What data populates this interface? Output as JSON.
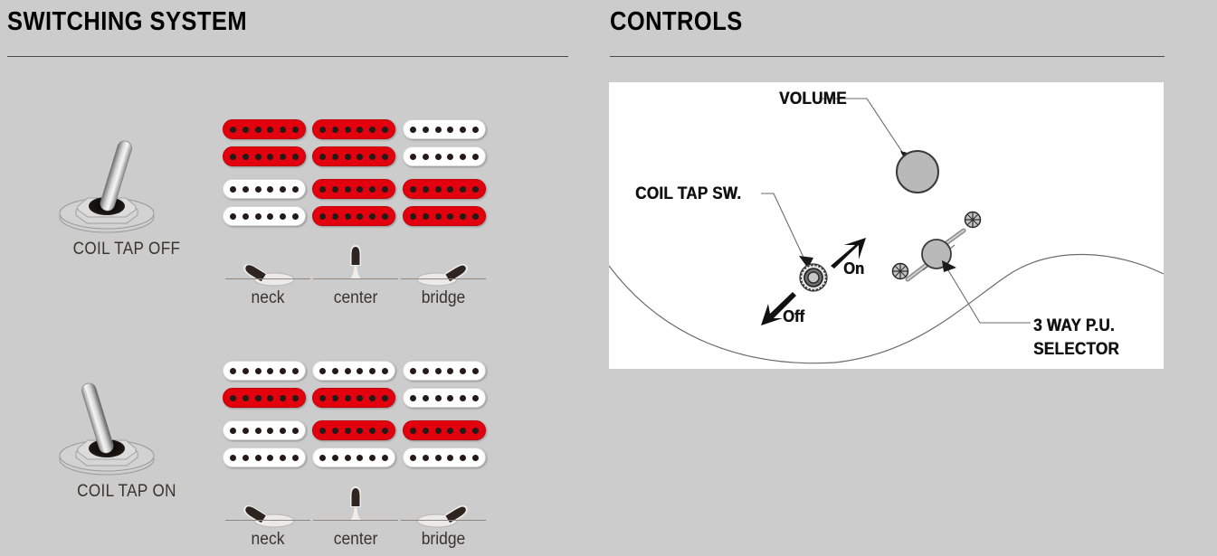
{
  "page": {
    "background_color": "#cccccc",
    "panel_color": "#ffffff",
    "active_coil_color": "#e2000f",
    "inactive_coil_color": "#ffffff"
  },
  "switching": {
    "title": "SWITCHING SYSTEM",
    "modes": [
      {
        "toggle_label": "COIL TAP OFF",
        "toggle_state": "off",
        "toggle_lean": "right",
        "positions": [
          {
            "name": "neck",
            "label": "neck",
            "lever": "left",
            "pickups": [
              {
                "slot": "neck",
                "coils": [
                  "on",
                  "on"
                ]
              },
              {
                "slot": "bridge",
                "coils": [
                  "off",
                  "off"
                ]
              }
            ]
          },
          {
            "name": "center",
            "label": "center",
            "lever": "center",
            "pickups": [
              {
                "slot": "neck",
                "coils": [
                  "on",
                  "on"
                ]
              },
              {
                "slot": "bridge",
                "coils": [
                  "on",
                  "on"
                ]
              }
            ]
          },
          {
            "name": "bridge",
            "label": "bridge",
            "lever": "right",
            "pickups": [
              {
                "slot": "neck",
                "coils": [
                  "off",
                  "off"
                ]
              },
              {
                "slot": "bridge",
                "coils": [
                  "on",
                  "on"
                ]
              }
            ]
          }
        ]
      },
      {
        "toggle_label": "COIL TAP ON",
        "toggle_state": "on",
        "toggle_lean": "left",
        "positions": [
          {
            "name": "neck",
            "label": "neck",
            "lever": "left",
            "pickups": [
              {
                "slot": "neck",
                "coils": [
                  "off",
                  "on"
                ]
              },
              {
                "slot": "bridge",
                "coils": [
                  "off",
                  "off"
                ]
              }
            ]
          },
          {
            "name": "center",
            "label": "center",
            "lever": "center",
            "pickups": [
              {
                "slot": "neck",
                "coils": [
                  "off",
                  "on"
                ]
              },
              {
                "slot": "bridge",
                "coils": [
                  "on",
                  "off"
                ]
              }
            ]
          },
          {
            "name": "bridge",
            "label": "bridge",
            "lever": "right",
            "pickups": [
              {
                "slot": "neck",
                "coils": [
                  "off",
                  "off"
                ]
              },
              {
                "slot": "bridge",
                "coils": [
                  "on",
                  "off"
                ]
              }
            ]
          }
        ]
      }
    ],
    "pole_count": 6
  },
  "controls": {
    "title": "CONTROLS",
    "callouts": {
      "volume": "VOLUME",
      "coil_tap_sw": "COIL TAP SW.",
      "selector_line1": "3 WAY P.U.",
      "selector_line2": "SELECTOR"
    },
    "switch_positions": {
      "on": "On",
      "off": "Off"
    }
  }
}
